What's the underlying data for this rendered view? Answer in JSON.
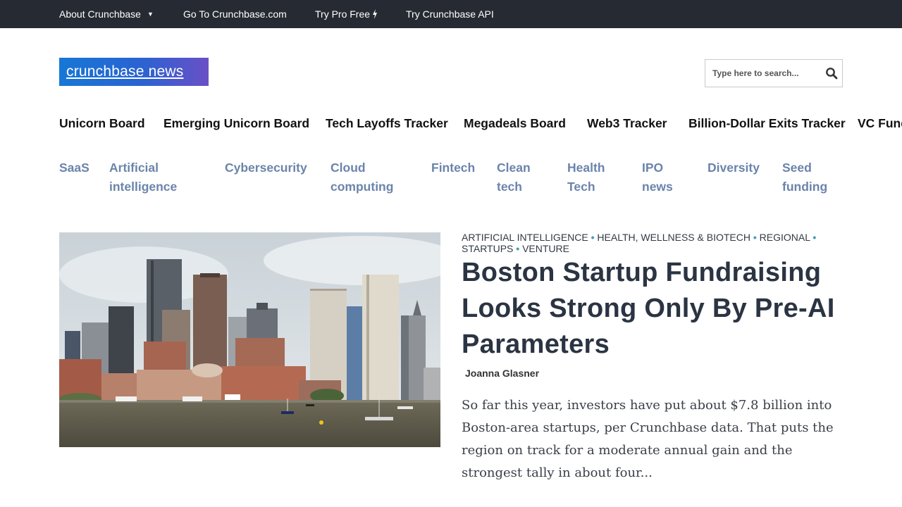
{
  "topbar": {
    "items": [
      {
        "label": "About Crunchbase",
        "has_caret": true
      },
      {
        "label": "Go To Crunchbase.com"
      },
      {
        "label": "Try Pro Free"
      },
      {
        "label": "Try Crunchbase API"
      }
    ]
  },
  "header": {
    "logo_text": "crunchbase news",
    "search_placeholder": "Type here to search..."
  },
  "main_nav": {
    "items": [
      "Unicorn Board",
      "Emerging Unicorn Board",
      "Tech Layoffs Tracker",
      "Megadeals Board",
      "Web3 Tracker",
      "Billion-Dollar Exits Tracker",
      "VC Funds"
    ]
  },
  "category_nav": {
    "items": [
      "SaaS",
      "Artificial intelligence",
      "Cybersecurity",
      "Cloud computing",
      "Fintech",
      "Clean tech",
      "Health Tech",
      "IPO news",
      "Diversity",
      "Seed funding"
    ]
  },
  "feature": {
    "image_alt": "Boston skyline from the harbor",
    "tags": [
      "Artificial Intelligence",
      "Health, Wellness & Biotech",
      "Regional",
      "Startups",
      "Venture"
    ],
    "title": "Boston Startup Fundraising Looks Strong Only By Pre-AI Parameters",
    "author": "Joanna Glasner",
    "excerpt": "So far this year, investors have put about $7.8 billion into Boston-area startups, per Crunchbase data. That puts the region on track for a moderate annual gain and the strongest tally in about four..."
  },
  "colors": {
    "topbar_bg": "#262b33",
    "logo_gradient_start": "#1777d6",
    "logo_gradient_end": "#6a4fc6",
    "category_link": "#6b84ab",
    "tag_separator": "#3c9ab8",
    "headline": "#2b3442"
  },
  "icons": {
    "caret": "caret-down-icon",
    "bolt": "lightning-bolt-icon",
    "search": "search-icon"
  }
}
